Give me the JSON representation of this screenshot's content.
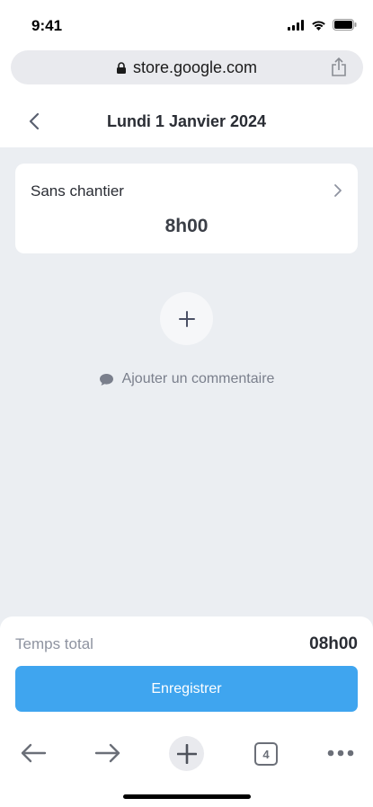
{
  "status_bar": {
    "time": "9:41"
  },
  "browser": {
    "url": "store.google.com",
    "open_tabs": "4"
  },
  "header": {
    "title": "Lundi 1 Janvier 2024"
  },
  "entry": {
    "label": "Sans chantier",
    "hours": "8h00"
  },
  "comment": {
    "label": "Ajouter un commentaire"
  },
  "summary": {
    "total_label": "Temps total",
    "total_value": "08h00"
  },
  "actions": {
    "save_label": "Enregistrer"
  },
  "colors": {
    "accent": "#3fa5ef",
    "background": "#ebeef2",
    "muted": "#8e93a0"
  }
}
